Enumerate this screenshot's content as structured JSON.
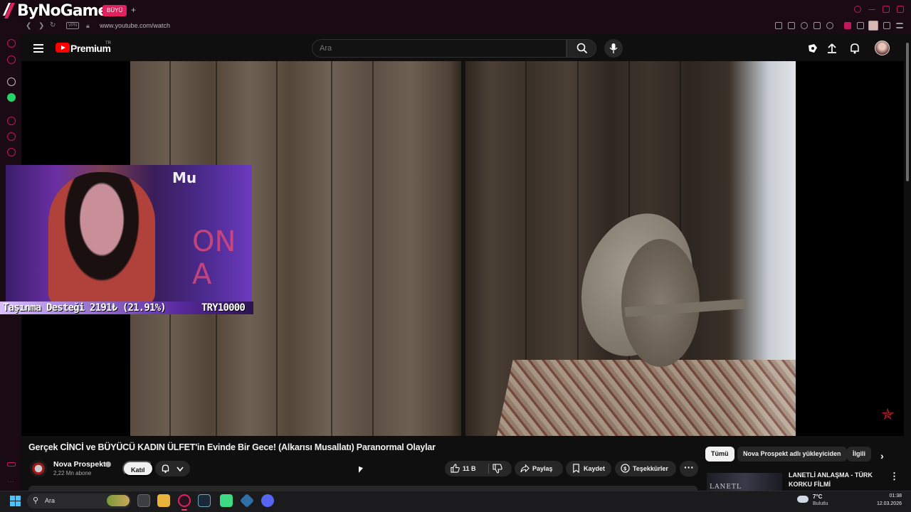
{
  "browser": {
    "brand": "ByNoGame",
    "tab_label": "BÜYÜ",
    "new_tab": "+",
    "vpn_label": "VPN",
    "url": "www.youtube.com/watch"
  },
  "youtube": {
    "logo_text": "Premium",
    "region": "TR",
    "search_placeholder": "Ara"
  },
  "overlay": {
    "cam_text": "Mu",
    "cam_sign": "ON A",
    "donation_text": "Taşınma Desteği 2191₺ (21.91%)",
    "donation_goal": "TRY10000",
    "donation_progress": 0.2191
  },
  "video": {
    "title": "Gerçek CİNCİ ve BÜYÜCÜ KADIN ÜLFET'in Evinde Bir Gece! (Alkarısı Musallatı) Paranormal Olaylar",
    "channel_name": "Nova Prospekt",
    "subscribers": "2,22 Mn abone",
    "join_label": "Katıl",
    "like_count": "11 B",
    "share_label": "Paylaş",
    "save_label": "Kaydet",
    "thanks_label": "Teşekkürler",
    "more_label": "···"
  },
  "sidebar_right": {
    "chips": [
      {
        "label": "Tümü",
        "active": true
      },
      {
        "label": "Nova Prospekt adlı yükleyiciden",
        "active": false
      },
      {
        "label": "İlgili",
        "active": false
      }
    ],
    "recommendation": {
      "title": "LANETLİ ANLAŞMA - TÜRK KORKU FİLMİ",
      "thumb_text": "LANETL"
    }
  },
  "taskbar": {
    "search_label": "Ara",
    "weather_temp": "7°C",
    "weather_desc": "Bulutlu",
    "time": "01:38",
    "date": "12.03.2026"
  },
  "colors": {
    "browser_accent": "#e0235e",
    "yt_red": "#ff0000",
    "whatsapp": "#25d366"
  }
}
